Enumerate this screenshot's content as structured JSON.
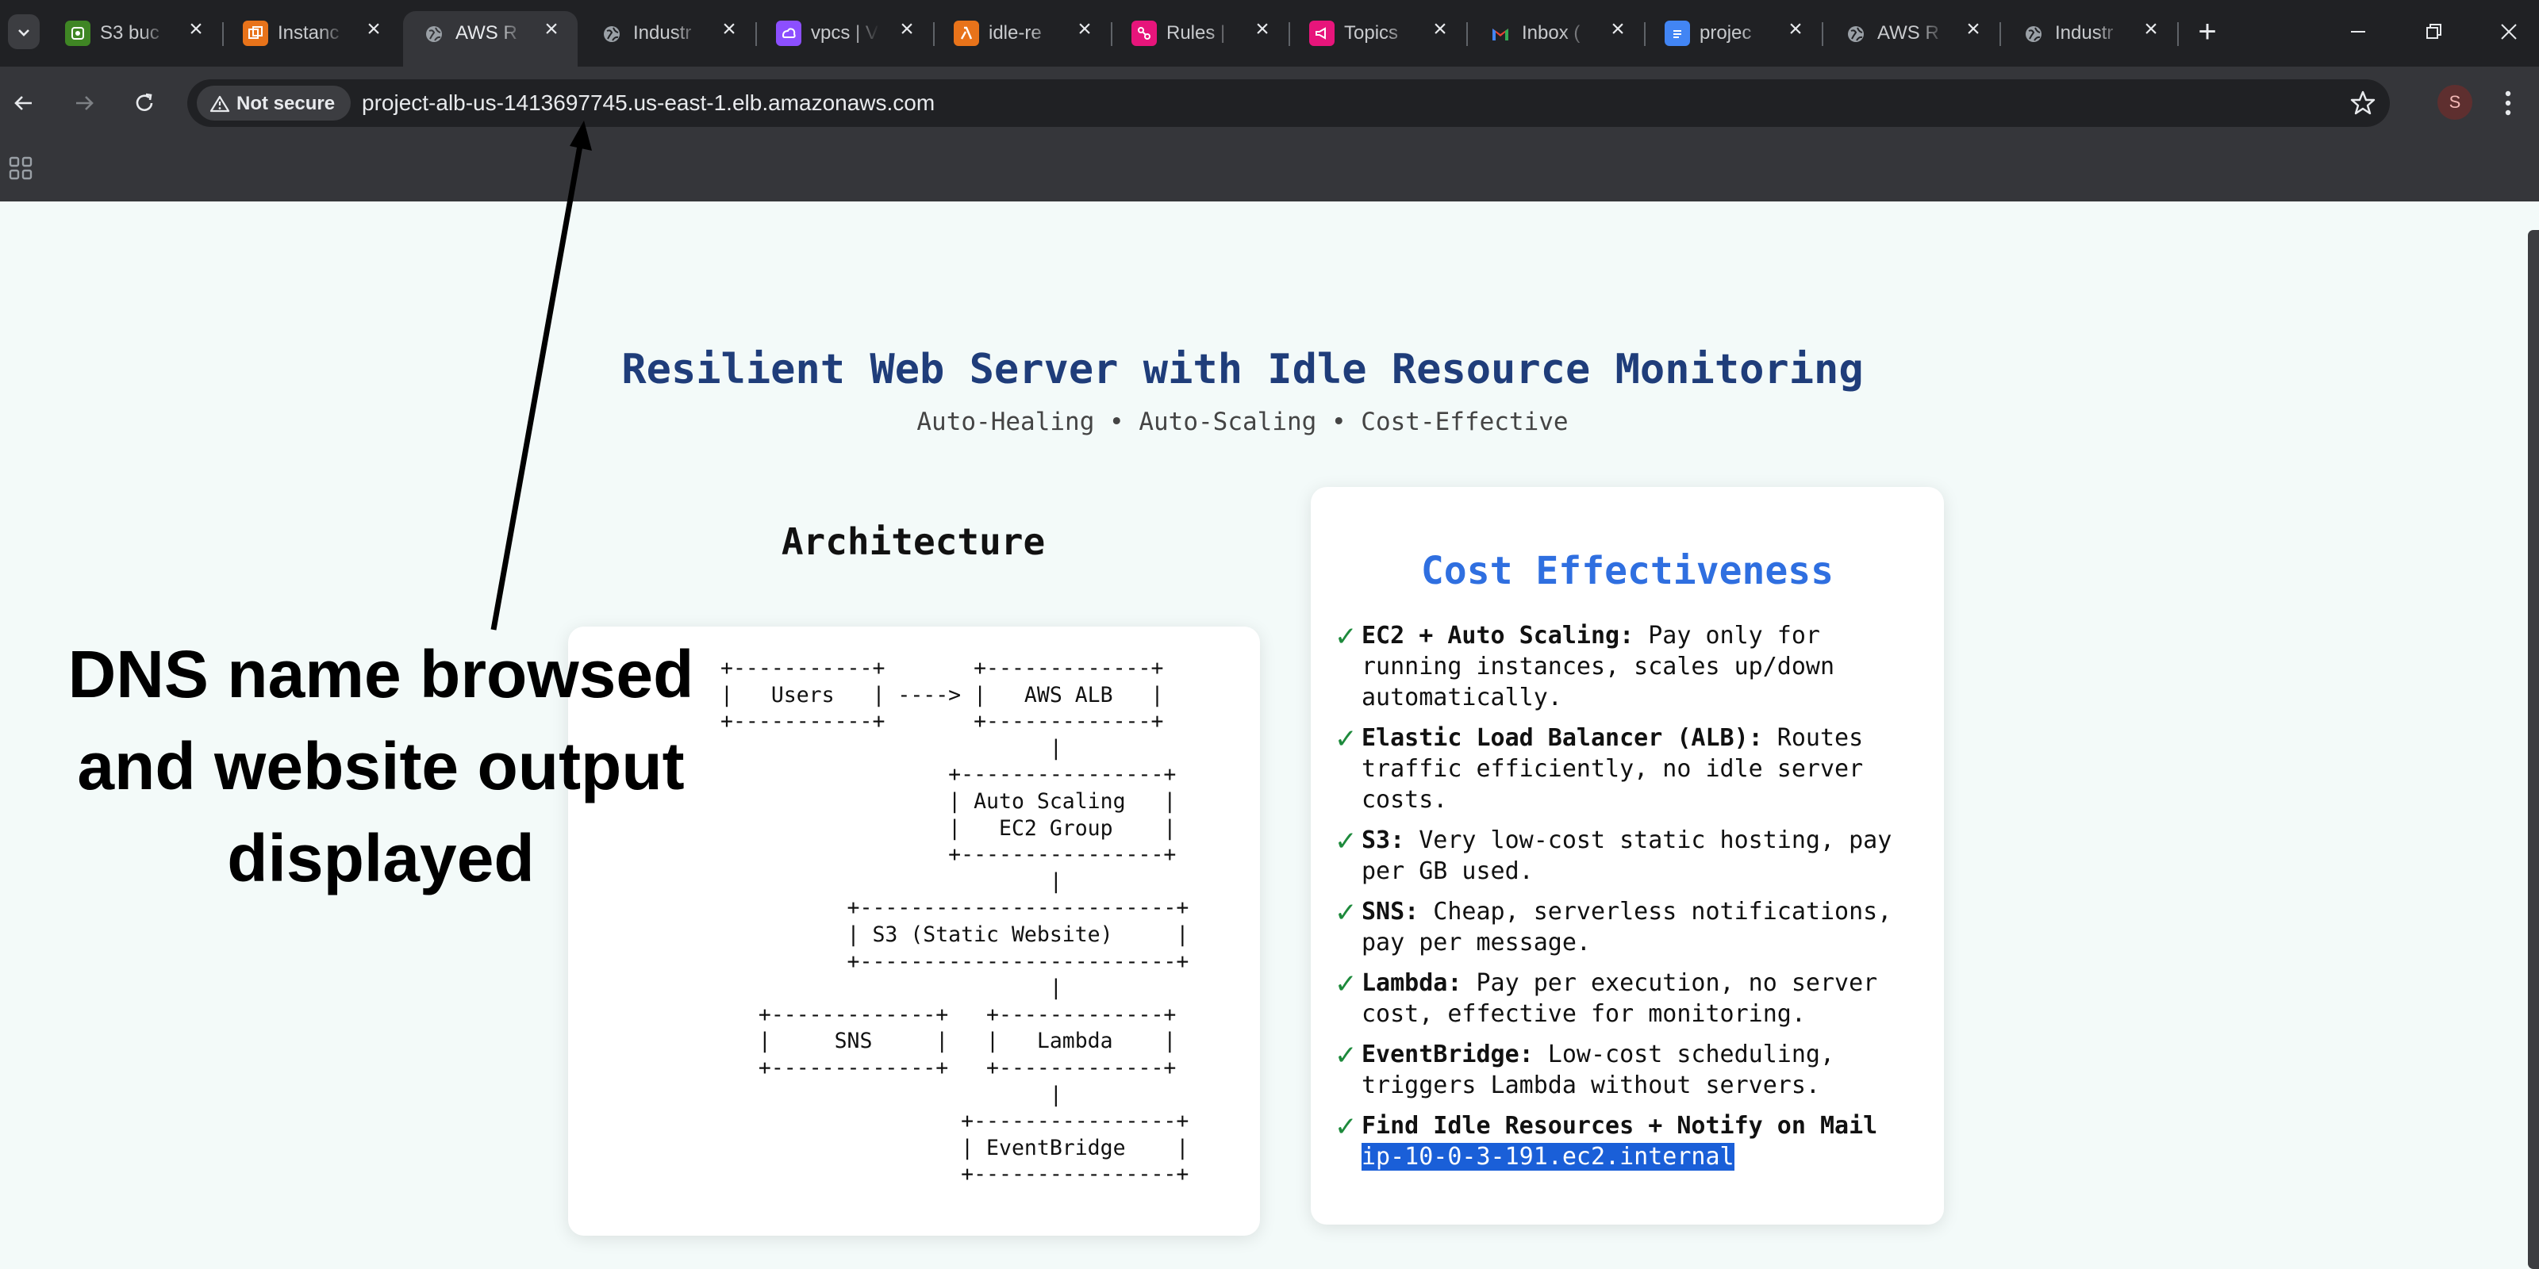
{
  "browser": {
    "tabs": [
      {
        "label": "S3 buc",
        "icon": "s3-icon",
        "color": "#3f8624",
        "active": false
      },
      {
        "label": "Instanc",
        "icon": "ec2-icon",
        "color": "#e8731a",
        "active": false
      },
      {
        "label": "AWS R",
        "icon": "globe-icon",
        "color": "",
        "active": true
      },
      {
        "label": "Industr",
        "icon": "globe-icon",
        "color": "",
        "active": false
      },
      {
        "label": "vpcs | V",
        "icon": "vpc-icon",
        "color": "#8c4fff",
        "active": false
      },
      {
        "label": "idle-re",
        "icon": "lambda-icon",
        "color": "#e8731a",
        "active": false
      },
      {
        "label": "Rules |",
        "icon": "eventbridge-icon",
        "color": "#e7157b",
        "active": false
      },
      {
        "label": "Topics",
        "icon": "sns-icon",
        "color": "#e7157b",
        "active": false
      },
      {
        "label": "Inbox (",
        "icon": "gmail-icon",
        "color": "",
        "active": false
      },
      {
        "label": "projec",
        "icon": "docs-icon",
        "color": "#4285f4",
        "active": false
      },
      {
        "label": "AWS R",
        "icon": "globe-icon",
        "color": "",
        "active": false
      },
      {
        "label": "Industr",
        "icon": "globe-icon",
        "color": "",
        "active": false
      }
    ],
    "security_label": "Not secure",
    "url": "project-alb-us-1413697745.us-east-1.elb.amazonaws.com",
    "profile_initial": "S"
  },
  "page": {
    "title": "Resilient Web Server with Idle Resource Monitoring",
    "subtitle": "Auto-Healing • Auto-Scaling • Cost-Effective",
    "architecture": {
      "heading": "Architecture",
      "diagram": "+-----------+       +-------------+\n|   Users   | ----> |   AWS ALB   |\n+-----------+       +-------------+\n                          |\n                  +----------------+\n                  | Auto Scaling   |\n                  |   EC2 Group    |\n                  +----------------+\n                          |\n          +-------------------------+\n          | S3 (Static Website)     |\n          +-------------------------+\n                          |\n   +-------------+   +-------------+\n   |     SNS     |   |   Lambda    |\n   +-------------+   +-------------+\n                          |\n                   +----------------+\n                   | EventBridge    |\n                   +----------------+"
    },
    "cost": {
      "title": "Cost Effectiveness",
      "check_glyph": "✓",
      "items": [
        {
          "label": "EC2 + Auto Scaling:",
          "text": " Pay only for running instances, scales up/down automatically."
        },
        {
          "label": "Elastic Load Balancer (ALB):",
          "text": " Routes traffic efficiently, no idle server costs."
        },
        {
          "label": "S3:",
          "text": " Very low-cost static hosting, pay per GB used."
        },
        {
          "label": "SNS:",
          "text": " Cheap, serverless notifications, pay per message."
        },
        {
          "label": "Lambda:",
          "text": " Pay per execution, no server cost, effective for monitoring."
        },
        {
          "label": "EventBridge:",
          "text": " Low-cost scheduling, triggers Lambda without servers."
        },
        {
          "label": "Find Idle Resources + Notify on Mail",
          "text": ""
        }
      ],
      "hostname": "ip-10-0-3-191.ec2.internal"
    }
  },
  "annotation": {
    "text": "DNS name browsed and website output displayed"
  },
  "colors": {
    "title": "#1f3d7a",
    "cost_title": "#2f6fe0",
    "check": "#1e8a3c",
    "selection": "#1a5fd8",
    "page_bg": "#f3faf9"
  }
}
